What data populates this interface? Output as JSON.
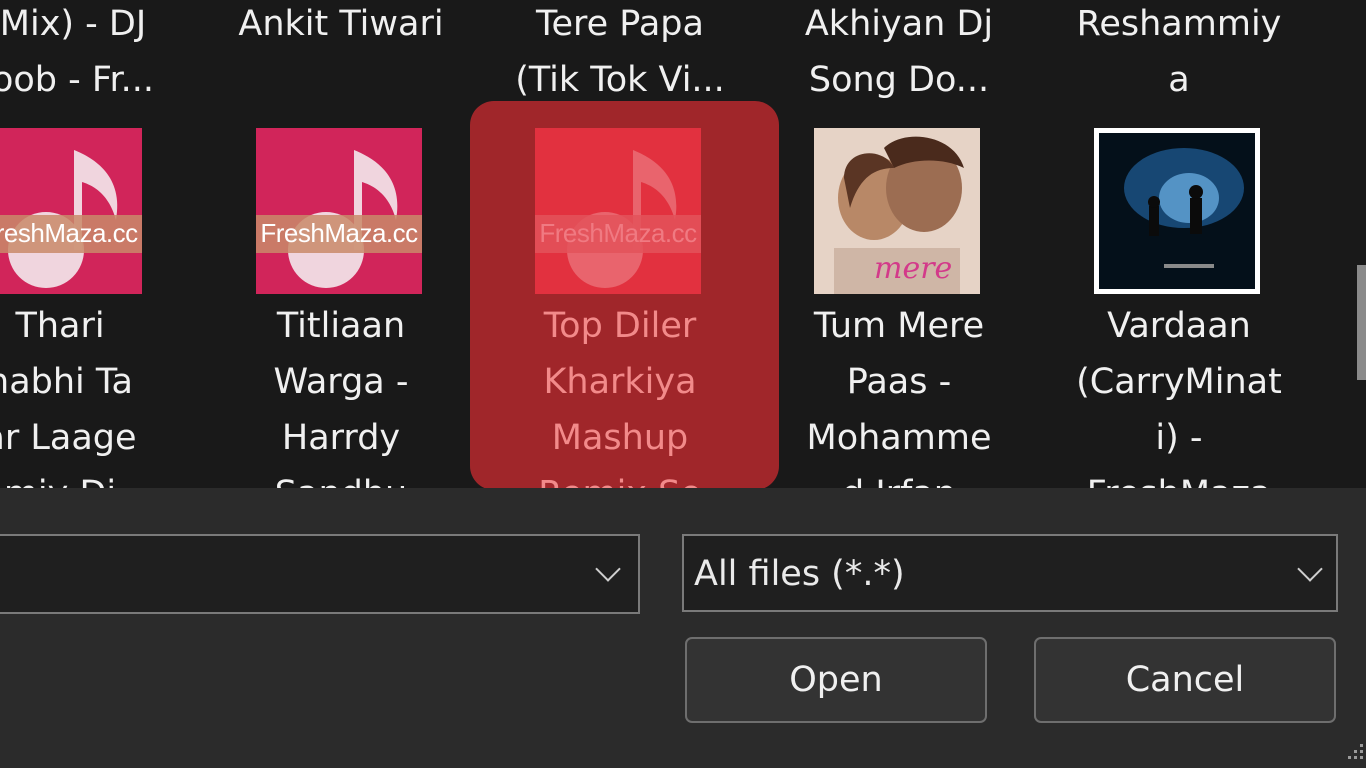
{
  "files": {
    "row1": [
      {
        "line1": "Mix) - DJ",
        "line2": "oob - Fr..."
      },
      {
        "line1": "Ankit Tiwari",
        "line2": ""
      },
      {
        "line1": "Tere Papa",
        "line2": "(Tik Tok Vi..."
      },
      {
        "line1": "Akhiyan Dj",
        "line2": "Song Do..."
      },
      {
        "line1": "Reshammiy",
        "line2": "a"
      }
    ],
    "row2": [
      {
        "thumb_text": "FreshMaza.cc",
        "lines": [
          "Thari",
          "habhi Ta",
          "ar Laage",
          "miy Dj"
        ]
      },
      {
        "thumb_text": "FreshMaza.cc",
        "lines": [
          "Titliaan",
          "Warga -",
          "Harrdy",
          "Sandhu"
        ]
      },
      {
        "thumb_text": "FreshMaza.cc",
        "lines": [
          "Top Diler",
          "Kharkiya",
          "Mashup",
          "Remix So"
        ],
        "selected": true
      },
      {
        "thumb_image": "album-art-couple",
        "lines": [
          "Tum Mere",
          "Paas -",
          "Mohamme",
          "d Irfan"
        ]
      },
      {
        "thumb_image": "album-art-night-figures",
        "lines": [
          "Vardaan",
          "(CarryMinat",
          "i) -",
          "FreshMaza"
        ]
      }
    ]
  },
  "filename_field": {
    "value": ""
  },
  "filetype_select": {
    "value": "All files (*.*)"
  },
  "buttons": {
    "open": "Open",
    "cancel": "Cancel"
  },
  "colors": {
    "accent_selection": "#a0262a",
    "thumb_default": "#d1255a",
    "background": "#191919"
  }
}
